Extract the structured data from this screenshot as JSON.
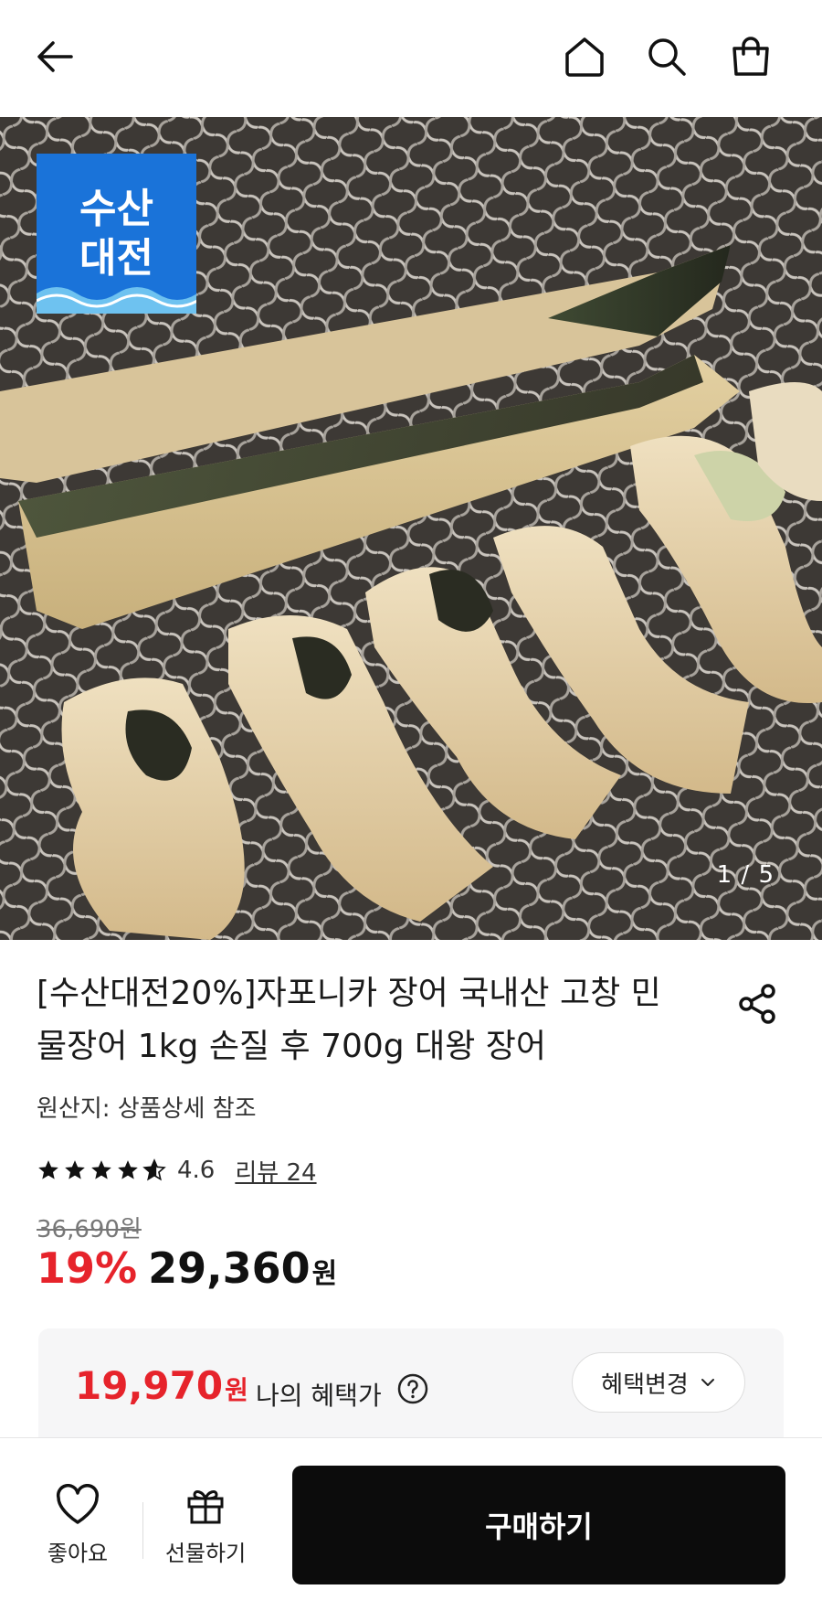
{
  "header": {
    "back_icon": "arrow-left-icon",
    "home_icon": "home-icon",
    "search_icon": "search-icon",
    "cart_icon": "shopping-bag-icon"
  },
  "gallery": {
    "badge_line1": "수산",
    "badge_line2": "대전",
    "counter": "1 / 5"
  },
  "product": {
    "title": "[수산대전20%]자포니카 장어 국내산 고창 민물장어 1kg 손질 후 700g 대왕 장어",
    "origin": "원산지: 상품상세 참조",
    "rating": "4.6",
    "rating_stars": 4.6,
    "review_link": "리뷰 24",
    "original_price": "36,690원",
    "discount": "19%",
    "price": "29,360",
    "price_unit": "원"
  },
  "benefit": {
    "price": "19,970",
    "price_unit": "원",
    "label": "나의 혜택가",
    "change_button": "혜택변경"
  },
  "bottom_bar": {
    "like_label": "좋아요",
    "gift_label": "선물하기",
    "buy_label": "구매하기"
  },
  "colors": {
    "accent_red": "#e6232b",
    "badge_blue": "#1a73d9",
    "buy_button": "#0c0c0c"
  }
}
